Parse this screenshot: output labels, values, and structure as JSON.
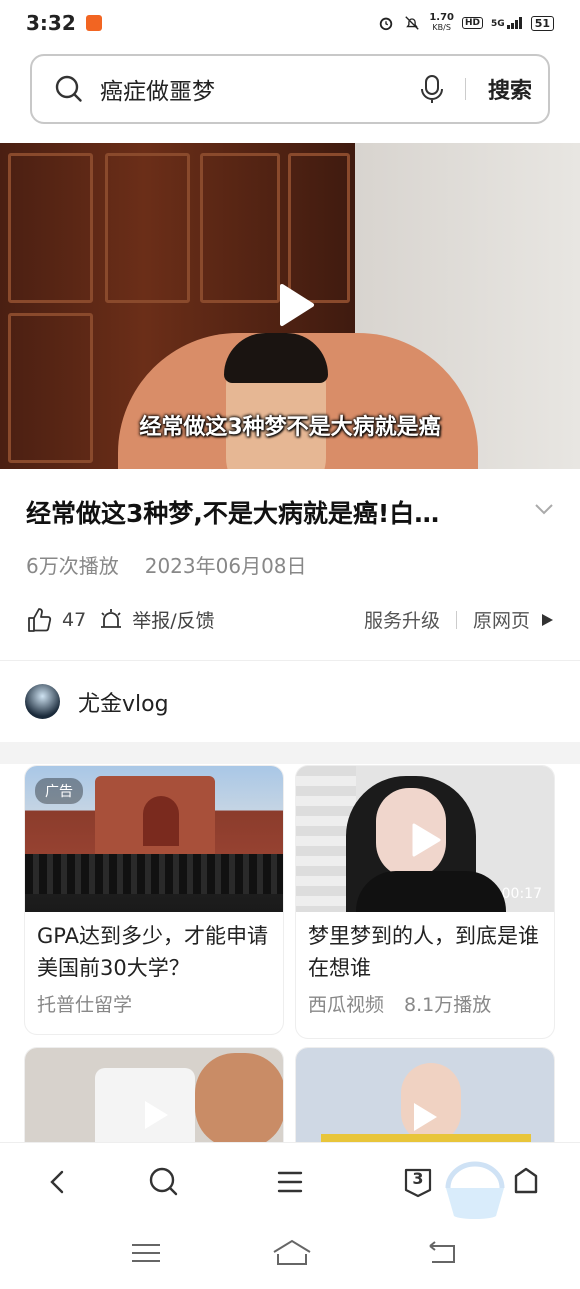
{
  "status_bar": {
    "time": "3:32",
    "network_speed_value": "1.70",
    "network_speed_unit": "KB/S",
    "hd": "HD",
    "signal": "5G",
    "battery": "51"
  },
  "search": {
    "query": "癌症做噩梦",
    "search_label": "搜索"
  },
  "video": {
    "caption": "经常做这3种梦不是大病就是癌",
    "title": "经常做这3种梦,不是大病就是癌!白…",
    "views": "6万次播放",
    "date": "2023年06月08日",
    "likes": "47",
    "report_label": "举报/反馈",
    "service_upgrade": "服务升级",
    "original_page": "原网页"
  },
  "author": {
    "name": "尤金vlog"
  },
  "feed": [
    {
      "title": "GPA达到多少，才能申请美国前30大学？",
      "source": "托普仕留学",
      "plays": "",
      "tag": "广告"
    },
    {
      "title": "梦里梦到的人，到底是谁在想谁",
      "source": "西瓜视频",
      "plays": "8.1万播放",
      "duration": "00:17"
    }
  ],
  "bottom_nav": {
    "tab_count": "3"
  },
  "colors": {
    "accent_text": "#222222",
    "meta_gray": "#888888"
  }
}
